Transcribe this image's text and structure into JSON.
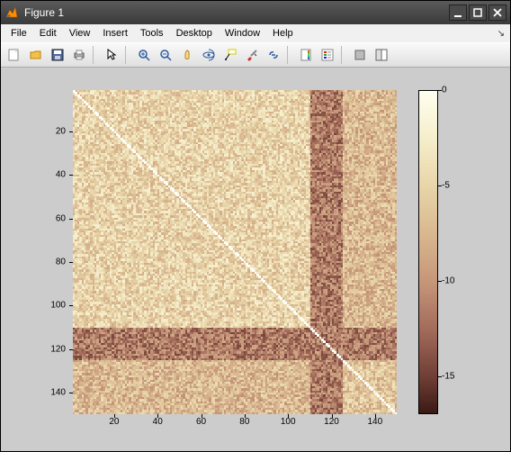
{
  "window": {
    "title": "Figure 1"
  },
  "menubar": {
    "items": [
      "File",
      "Edit",
      "View",
      "Insert",
      "Tools",
      "Desktop",
      "Window",
      "Help"
    ]
  },
  "toolbar": {
    "icons": [
      "new-figure-icon",
      "open-icon",
      "save-icon",
      "print-icon",
      "pointer-icon",
      "zoom-in-icon",
      "zoom-out-icon",
      "pan-icon",
      "rotate3d-icon",
      "data-cursor-icon",
      "brush-icon",
      "link-icon",
      "colorbar-icon",
      "legend-icon",
      "hide-tools-icon",
      "dock-icon"
    ]
  },
  "axes": {
    "xticks": [
      20,
      40,
      60,
      80,
      100,
      120,
      140
    ],
    "yticks": [
      20,
      40,
      60,
      80,
      100,
      120,
      140
    ],
    "xrange": [
      1,
      150
    ],
    "yrange": [
      1,
      150
    ]
  },
  "colorbar": {
    "ticks": [
      0,
      -5,
      -10,
      -15
    ],
    "range": [
      -17,
      0
    ]
  },
  "chart_data": {
    "type": "heatmap",
    "title": "",
    "xlabel": "",
    "ylabel": "",
    "xlim": [
      1,
      150
    ],
    "ylim": [
      1,
      150
    ],
    "clim": [
      -17,
      0
    ],
    "colormap": "pink_reversed_approx",
    "description": "150x150 symmetric matrix (log-scale values). Diagonal near 0 (white). Off-diagonal values mostly between -3 and -12 with block structure: brighter block ~1-110, darker band rows/cols ~115-125, moderate block ~125-150. Representative sample values below.",
    "blocks": [
      {
        "rows": [
          1,
          110
        ],
        "cols": [
          1,
          110
        ],
        "mean_value": -5.0,
        "note": "main lighter block"
      },
      {
        "rows": [
          111,
          125
        ],
        "cols": [
          1,
          150
        ],
        "mean_value": -11.0,
        "note": "dark horizontal band"
      },
      {
        "rows": [
          1,
          150
        ],
        "cols": [
          111,
          125
        ],
        "mean_value": -11.0,
        "note": "dark vertical band"
      },
      {
        "rows": [
          126,
          150
        ],
        "cols": [
          126,
          150
        ],
        "mean_value": -6.0,
        "note": "secondary block"
      }
    ],
    "diagonal_value": 0,
    "sample_cells": [
      {
        "r": 10,
        "c": 10,
        "v": 0
      },
      {
        "r": 10,
        "c": 30,
        "v": -6
      },
      {
        "r": 10,
        "c": 60,
        "v": -4
      },
      {
        "r": 10,
        "c": 118,
        "v": -12
      },
      {
        "r": 10,
        "c": 140,
        "v": -7
      },
      {
        "r": 50,
        "c": 50,
        "v": 0
      },
      {
        "r": 50,
        "c": 20,
        "v": -5
      },
      {
        "r": 50,
        "c": 90,
        "v": -4
      },
      {
        "r": 50,
        "c": 120,
        "v": -13
      },
      {
        "r": 50,
        "c": 145,
        "v": -8
      },
      {
        "r": 118,
        "c": 118,
        "v": 0
      },
      {
        "r": 118,
        "c": 30,
        "v": -12
      },
      {
        "r": 118,
        "c": 140,
        "v": -10
      },
      {
        "r": 140,
        "c": 140,
        "v": 0
      },
      {
        "r": 140,
        "c": 30,
        "v": -7
      },
      {
        "r": 140,
        "c": 120,
        "v": -10
      }
    ]
  }
}
